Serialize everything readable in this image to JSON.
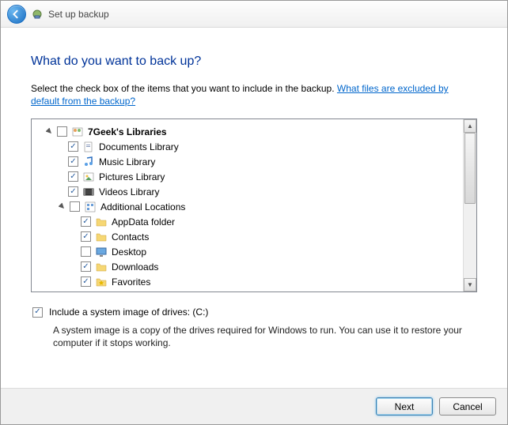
{
  "window": {
    "title": "Set up backup"
  },
  "page": {
    "heading": "What do you want to back up?",
    "intro_pre": "Select the check box of the items that you want to include in the backup. ",
    "intro_link": "What files are excluded by default from the backup?"
  },
  "tree": {
    "root": {
      "label": "7Geek's Libraries",
      "children": [
        {
          "label": "Documents Library",
          "icon": "doc",
          "checked": true
        },
        {
          "label": "Music Library",
          "icon": "music",
          "checked": true
        },
        {
          "label": "Pictures Library",
          "icon": "pic",
          "checked": true
        },
        {
          "label": "Videos Library",
          "icon": "video",
          "checked": true
        }
      ],
      "additional": {
        "label": "Additional Locations",
        "children": [
          {
            "label": "AppData folder",
            "icon": "folder",
            "checked": true
          },
          {
            "label": "Contacts",
            "icon": "folder",
            "checked": true
          },
          {
            "label": "Desktop",
            "icon": "desktop",
            "checked": false
          },
          {
            "label": "Downloads",
            "icon": "folder",
            "checked": true
          },
          {
            "label": "Favorites",
            "icon": "fav",
            "checked": true
          }
        ]
      }
    }
  },
  "system_image": {
    "label": "Include a system image of drives: (C:)",
    "checked": true,
    "desc": "A system image is a copy of the drives required for Windows to run. You can use it to restore your computer if it stops working."
  },
  "buttons": {
    "next": "Next",
    "cancel": "Cancel"
  }
}
